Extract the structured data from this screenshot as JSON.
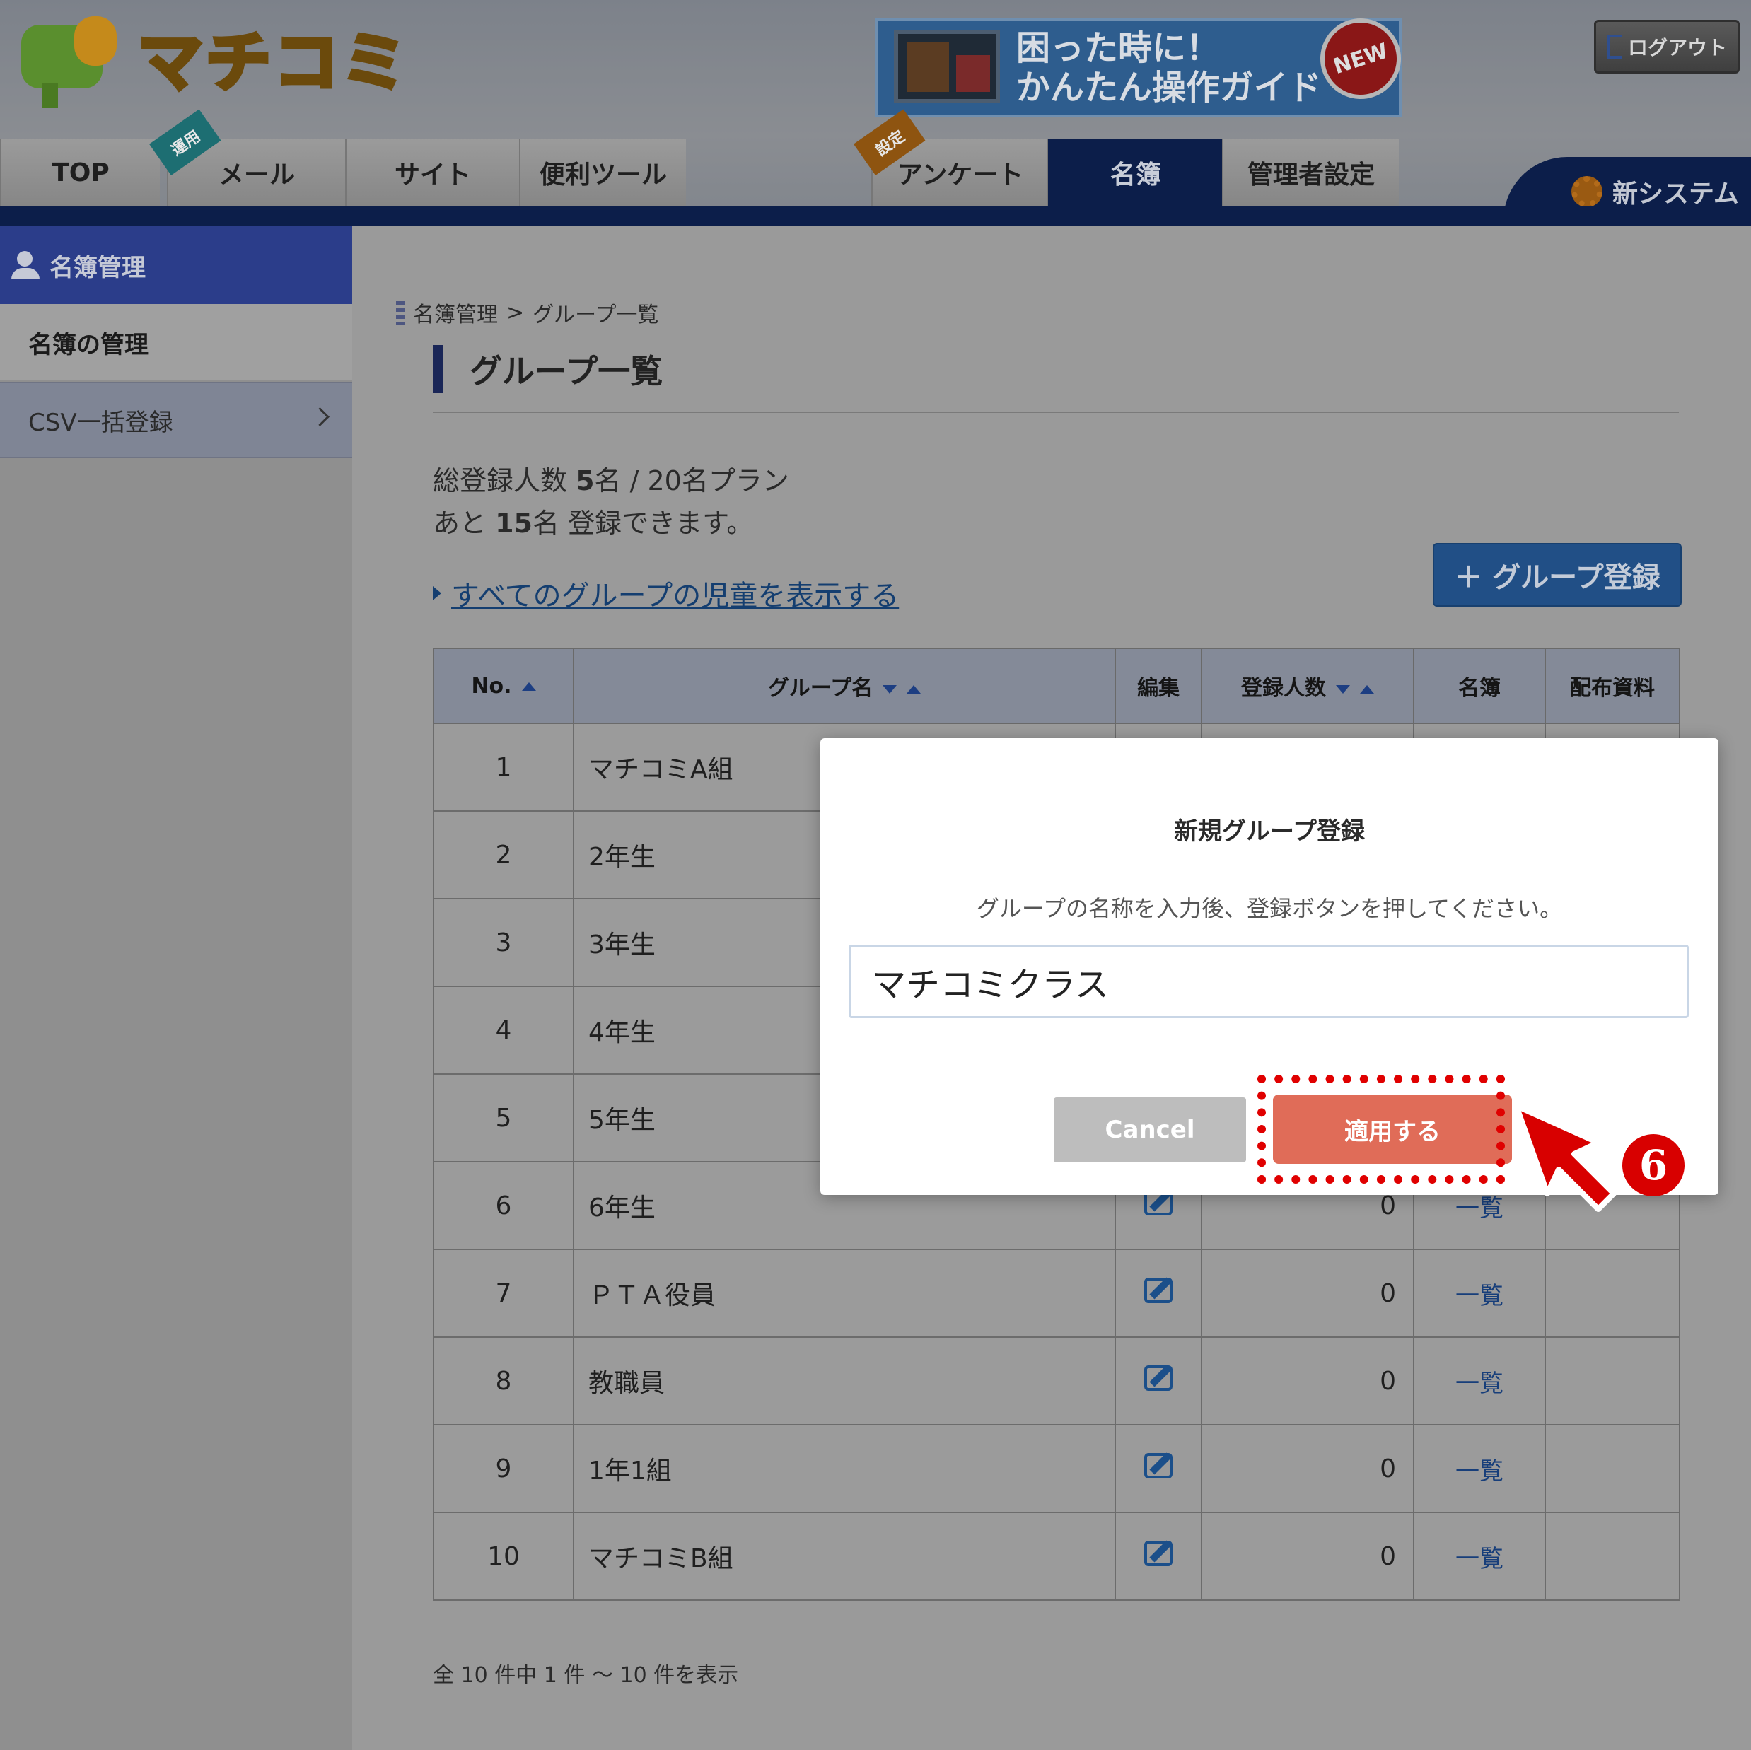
{
  "header": {
    "logo_text": "マチコミ",
    "guide_banner": {
      "line1": "困った時に！",
      "line2": "かんたん操作ガイド",
      "badge": "NEW"
    },
    "logout_label": "ログアウト",
    "nav": [
      {
        "label": "TOP"
      },
      {
        "label": "メール",
        "ribbon": "運用"
      },
      {
        "label": "サイト"
      },
      {
        "label": "便利ツール"
      },
      {
        "label": "アンケート",
        "ribbon": "設定"
      },
      {
        "label": "名簿",
        "active": true
      },
      {
        "label": "管理者設定"
      }
    ],
    "new_system_label": "新システム"
  },
  "sidebar": {
    "heading": "名簿管理",
    "items": [
      {
        "label": "名簿の管理",
        "selected": true
      },
      {
        "label": "CSV一括登録"
      }
    ]
  },
  "main": {
    "breadcrumb": {
      "parent": "名簿管理",
      "separator": ">",
      "current": "グループ一覧"
    },
    "title": "グループ一覧",
    "summary": {
      "line1_prefix": "総登録人数 ",
      "registered": "5",
      "line1_suffix": "名 / 20名プラン",
      "line2_prefix": "あと ",
      "remaining": "15",
      "line2_suffix": "名 登録できます。"
    },
    "show_all_link": "すべてのグループの児童を表示する",
    "add_group_button": "＋ グループ登録",
    "table": {
      "headers": [
        "No.",
        "グループ名",
        "編集",
        "登録人数",
        "名簿",
        "配布資料"
      ],
      "roster_link": "一覧",
      "rows": [
        {
          "no": "1",
          "name": "マチコミA組",
          "count": ""
        },
        {
          "no": "2",
          "name": "2年生",
          "count": ""
        },
        {
          "no": "3",
          "name": "3年生",
          "count": ""
        },
        {
          "no": "4",
          "name": "4年生",
          "count": ""
        },
        {
          "no": "5",
          "name": "5年生",
          "count": ""
        },
        {
          "no": "6",
          "name": "6年生",
          "count": "0"
        },
        {
          "no": "7",
          "name": "ＰＴＡ役員",
          "count": "0"
        },
        {
          "no": "8",
          "name": "教職員",
          "count": "0"
        },
        {
          "no": "9",
          "name": "1年1組",
          "count": "0"
        },
        {
          "no": "10",
          "name": "マチコミB組",
          "count": "0"
        }
      ]
    },
    "footer_count": "全 10 件中 1 件 ～ 10 件を表示"
  },
  "modal": {
    "title": "新規グループ登録",
    "description": "グループの名称を入力後、登録ボタンを押してください。",
    "input_value": "マチコミクラス",
    "cancel_label": "Cancel",
    "apply_label": "適用する"
  },
  "annotation": {
    "step": "6"
  },
  "colors": {
    "navy": "#0c1e4a",
    "apply": "#e06c58",
    "highlight": "#e00000"
  }
}
